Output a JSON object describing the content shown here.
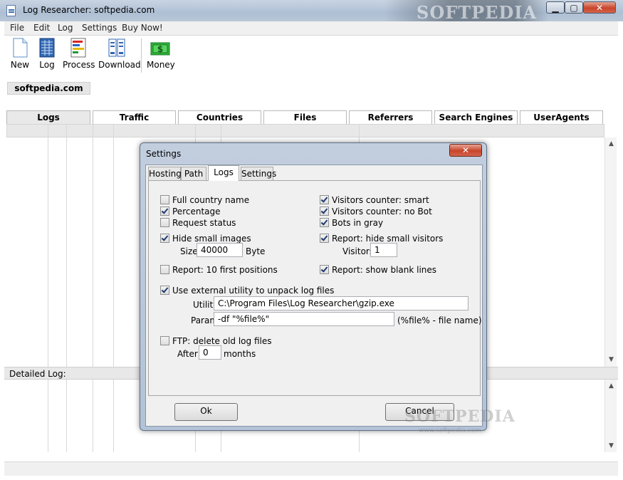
{
  "window": {
    "title": "Log Researcher: softpedia.com",
    "titlebar_watermark": "SOFTPEDIA"
  },
  "menu": [
    "File",
    "Edit",
    "Log",
    "Settings",
    "Buy Now!"
  ],
  "toolbar": {
    "new": "New",
    "log": "Log",
    "process": "Process",
    "download": "Download",
    "money": "Money"
  },
  "host": "softpedia.com",
  "tabs": [
    "Logs",
    "Traffic",
    "Countries",
    "Files",
    "Referrers",
    "Search Engines",
    "UserAgents"
  ],
  "detailed_label": "Detailed Log:",
  "dialog": {
    "title": "Settings",
    "tabs": [
      "Hosting",
      "Path",
      "Logs",
      "Settings"
    ],
    "options": {
      "full_country": {
        "label": "Full country name",
        "checked": false
      },
      "percentage": {
        "label": "Percentage",
        "checked": true
      },
      "request_status": {
        "label": "Request status",
        "checked": false
      },
      "hide_small_images": {
        "label": "Hide small images",
        "checked": true
      },
      "report_10": {
        "label": "Report: 10 first positions",
        "checked": false
      },
      "visitors_smart": {
        "label": "Visitors counter: smart",
        "checked": true
      },
      "visitors_nobot": {
        "label": "Visitors counter: no Bot",
        "checked": true
      },
      "bots_gray": {
        "label": "Bots in gray",
        "checked": true
      },
      "hide_small_visitors": {
        "label": "Report: hide small visitors",
        "checked": true
      },
      "blank_lines": {
        "label": "Report: show blank lines",
        "checked": true
      },
      "external_utility": {
        "label": "Use external utility to unpack log files",
        "checked": true
      },
      "ftp_delete": {
        "label": "FTP: delete old log files",
        "checked": false
      }
    },
    "size_label": "Size:",
    "size_value": "40000",
    "size_unit": "Byte",
    "visitors_label": "Visitors:",
    "visitors_value": "1",
    "utility_label": "Utility:",
    "utility_value": "C:\\Program Files\\Log Researcher\\gzip.exe",
    "param_label": "Param:",
    "param_value": "-df \"%file%\"",
    "param_hint": "(%file% - file name)",
    "after_label": "After:",
    "after_value": "0",
    "after_unit": "months",
    "ok": "Ok",
    "cancel": "Cancel"
  },
  "watermark": {
    "brand": "SOFTPEDIA",
    "url": "www.softpedia.com"
  }
}
